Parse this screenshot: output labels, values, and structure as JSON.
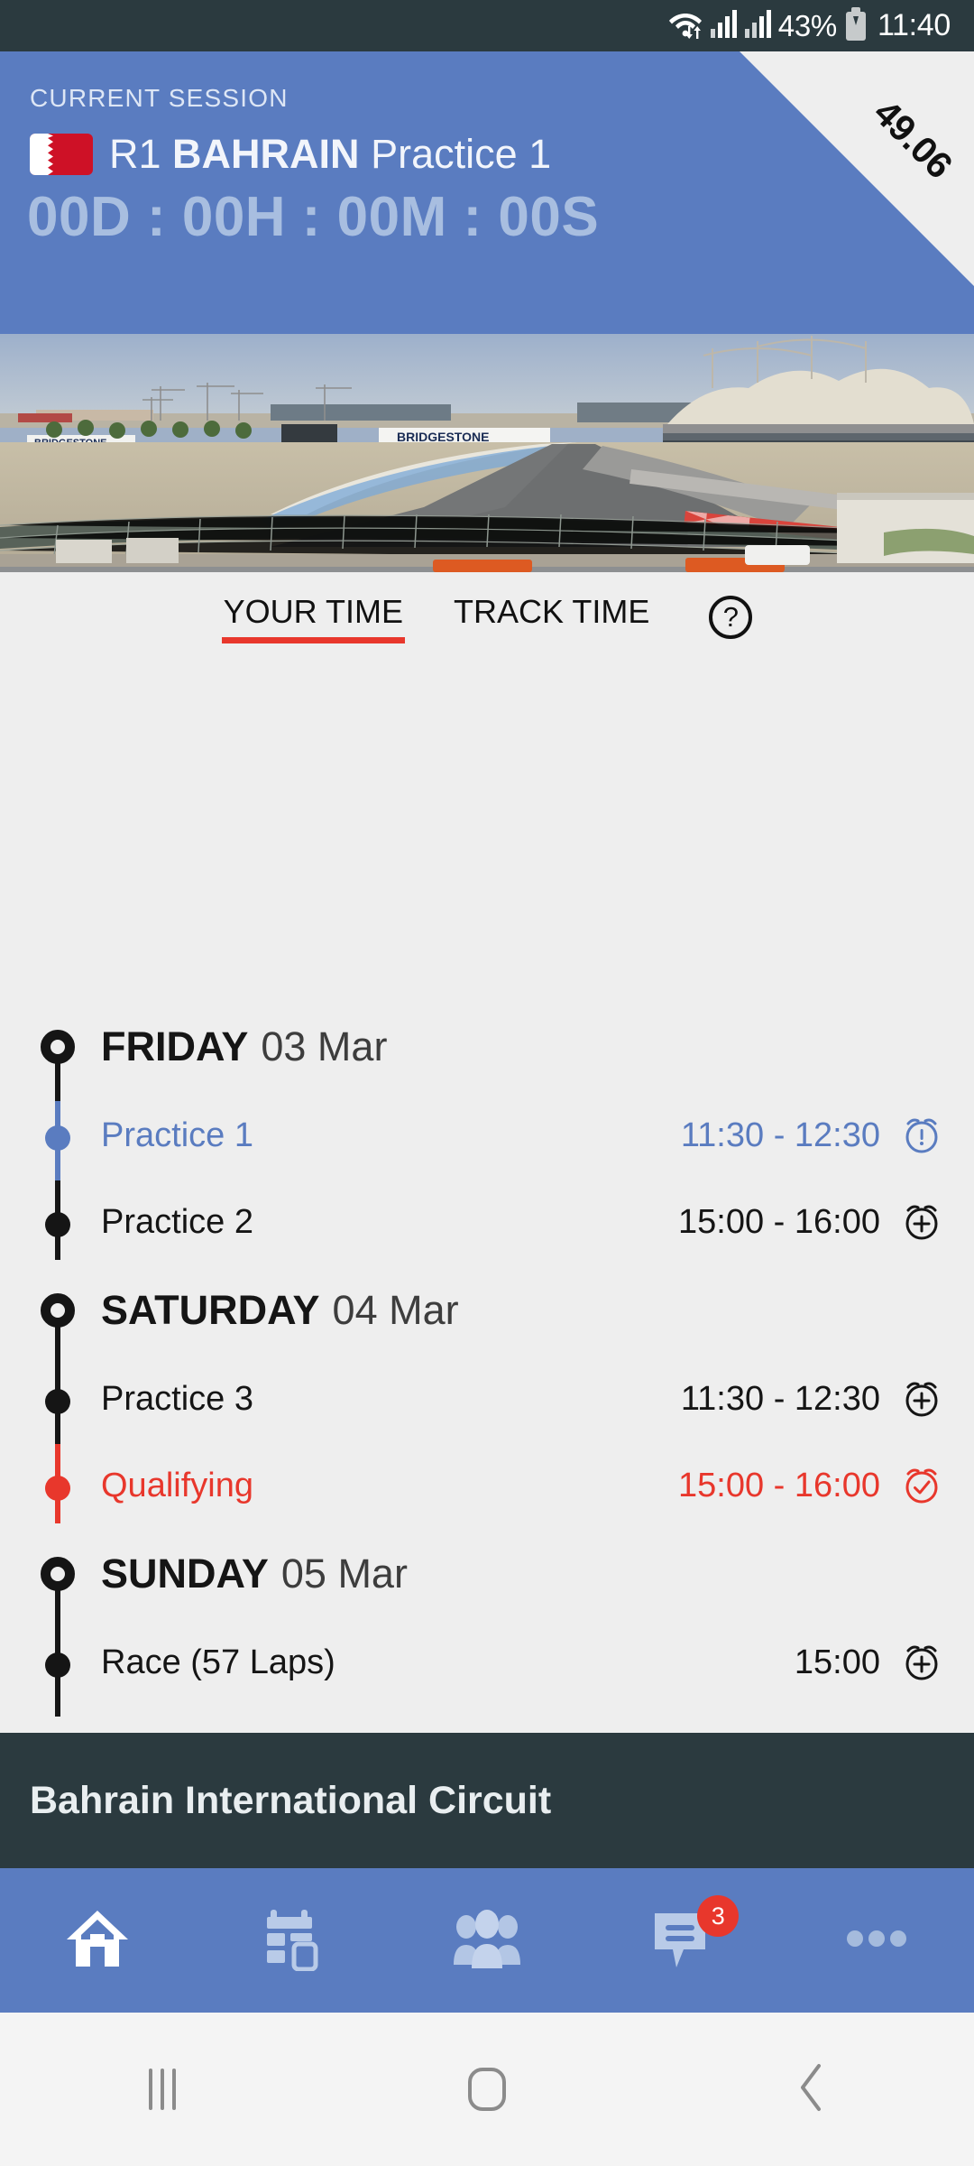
{
  "statusbar": {
    "wifi_icon": "wifi-icon",
    "signal_icon_1": "signal-bars-icon",
    "signal_icon_2": "signal-bars-icon",
    "battery_percent": "43%",
    "battery_icon": "battery-charging-icon",
    "clock": "11:40"
  },
  "header": {
    "eyebrow": "CURRENT SESSION",
    "flag_icon": "bahrain-flag-icon",
    "round": "R1",
    "country": "BAHRAIN",
    "session": "Practice 1",
    "countdown": "00D : 00H : 00M : 00S",
    "corner_value": "49.06",
    "background_color": "#5a7cc0",
    "corner_color": "#eeeeee"
  },
  "hero": {
    "alt_name": "bahrain-circuit-photo"
  },
  "tabs": {
    "items": [
      {
        "label": "YOUR TIME",
        "active": true
      },
      {
        "label": "TRACK TIME",
        "active": false
      }
    ],
    "help_icon": "help-circle-icon",
    "active_underline_color": "#e8372c"
  },
  "schedule": {
    "days": [
      {
        "name": "FRIDAY",
        "date": "03 Mar",
        "sessions": [
          {
            "name": "Practice 1",
            "time": "11:30 - 12:30",
            "state": "current",
            "alarm_icon": "alarm-alert-icon",
            "color": "#5a7cc0"
          },
          {
            "name": "Practice 2",
            "time": "15:00 - 16:00",
            "state": "normal",
            "alarm_icon": "alarm-add-icon",
            "color": "#151515"
          }
        ]
      },
      {
        "name": "SATURDAY",
        "date": "04 Mar",
        "sessions": [
          {
            "name": "Practice 3",
            "time": "11:30 - 12:30",
            "state": "normal",
            "alarm_icon": "alarm-add-icon",
            "color": "#151515"
          },
          {
            "name": "Qualifying",
            "time": "15:00 - 16:00",
            "state": "alerted",
            "alarm_icon": "alarm-set-check-icon",
            "color": "#e8372c"
          }
        ]
      },
      {
        "name": "SUNDAY",
        "date": "05 Mar",
        "sessions": [
          {
            "name": "Race (57 Laps)",
            "time": "15:00",
            "state": "normal",
            "alarm_icon": "alarm-add-icon",
            "color": "#151515"
          }
        ]
      }
    ]
  },
  "circuit": {
    "name": "Bahrain International Circuit",
    "background_color": "#2b3a3f"
  },
  "bottomnav": {
    "items": [
      {
        "icon": "home-icon",
        "active": true
      },
      {
        "icon": "calendar-icon",
        "active": false
      },
      {
        "icon": "people-icon",
        "active": false
      },
      {
        "icon": "chat-icon",
        "active": false,
        "badge": "3"
      },
      {
        "icon": "more-dots-icon",
        "active": false
      }
    ],
    "background_color": "#5a7cc0",
    "badge_color": "#e8372c"
  },
  "sysnav": {
    "items": [
      {
        "icon": "recents-icon"
      },
      {
        "icon": "home-square-icon"
      },
      {
        "icon": "back-chevron-icon"
      }
    ]
  }
}
